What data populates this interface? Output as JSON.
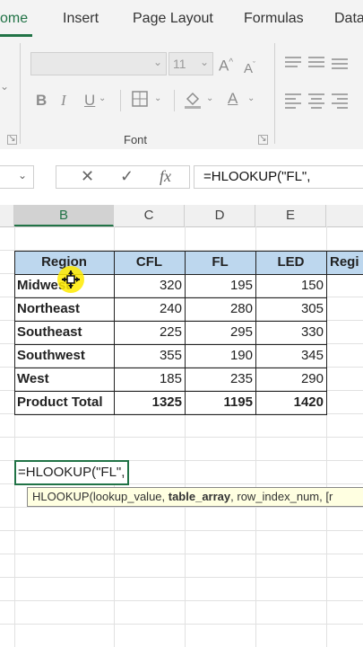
{
  "ribbon_tabs": [
    "ome",
    "Insert",
    "Page Layout",
    "Formulas",
    "Data"
  ],
  "ribbon": {
    "font_size": "11",
    "font_group_label": "Font",
    "buttons": {
      "grow_font": "A",
      "shrink_font": "A",
      "bold": "B",
      "italic": "I",
      "underline": "U",
      "font_color": "A"
    }
  },
  "formula_bar": {
    "cancel": "✕",
    "enter": "✓",
    "fx": "fx",
    "formula": "=HLOOKUP(\"FL\","
  },
  "columns": [
    "B",
    "C",
    "D",
    "E"
  ],
  "table": {
    "headers": [
      "Region",
      "CFL",
      "FL",
      "LED",
      "Regi"
    ],
    "rows": [
      {
        "region": "Midwest",
        "cfl": "320",
        "fl": "195",
        "led": "150"
      },
      {
        "region": "Northeast",
        "cfl": "240",
        "fl": "280",
        "led": "305"
      },
      {
        "region": "Southeast",
        "cfl": "225",
        "fl": "295",
        "led": "330"
      },
      {
        "region": "Southwest",
        "cfl": "355",
        "fl": "190",
        "led": "345"
      },
      {
        "region": "West",
        "cfl": "185",
        "fl": "235",
        "led": "290"
      }
    ],
    "total": {
      "region": "Product Total",
      "cfl": "1325",
      "fl": "1195",
      "led": "1420"
    }
  },
  "active_cell": {
    "value": "=HLOOKUP(\"FL\","
  },
  "tooltip": {
    "fn": "HLOOKUP(",
    "arg1": "lookup_value, ",
    "arg2": "table_array",
    "rest": ", row_index_num, [r"
  },
  "colors": {
    "accent": "#217346",
    "header_fill": "#bdd7ee",
    "tooltip_bg": "#ffffe1"
  }
}
